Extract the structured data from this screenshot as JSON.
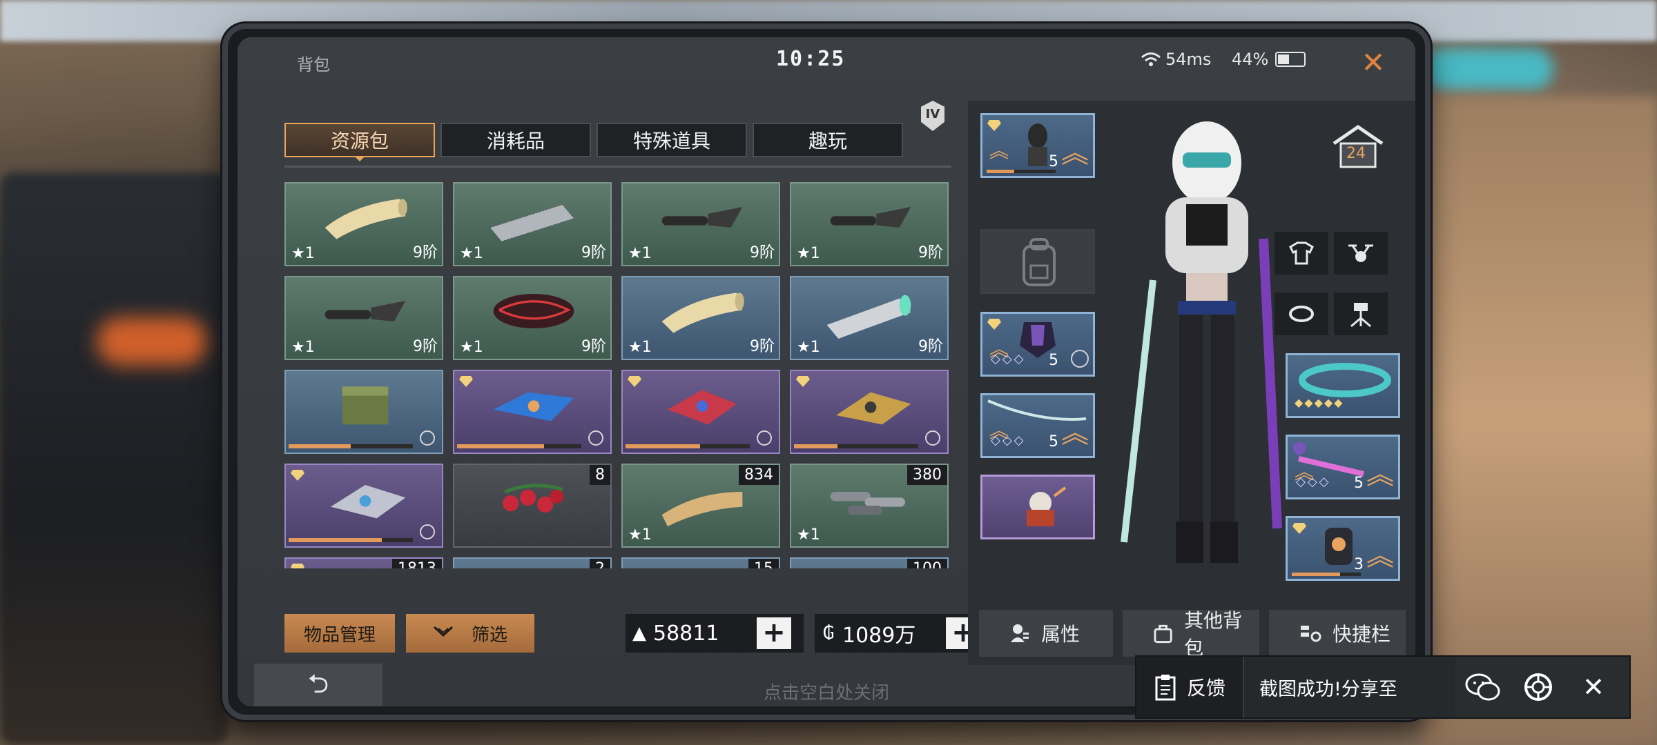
{
  "status": {
    "title": "背包",
    "time": "10:25",
    "ping": "54ms",
    "battery": "44%",
    "battery_level": 0.44
  },
  "tabs": [
    {
      "label": "资源包",
      "active": true
    },
    {
      "label": "消耗品",
      "active": false
    },
    {
      "label": "特殊道具",
      "active": false
    },
    {
      "label": "趣玩",
      "active": false
    }
  ],
  "tier_badge": "IV",
  "items": [
    {
      "icon": "cloth-roll-icon",
      "rarity": "green",
      "star": "1",
      "tier": "9阶"
    },
    {
      "icon": "mesh-roll-icon",
      "rarity": "green",
      "star": "1",
      "tier": "9阶"
    },
    {
      "icon": "gun-stock-icon",
      "rarity": "green",
      "star": "1",
      "tier": "9阶"
    },
    {
      "icon": "gun-stock-icon",
      "rarity": "green",
      "star": "1",
      "tier": "9阶"
    },
    {
      "icon": "gun-stock-icon",
      "rarity": "green",
      "star": "1",
      "tier": "9阶"
    },
    {
      "icon": "armor-plate-icon",
      "rarity": "green",
      "star": "1",
      "tier": "9阶"
    },
    {
      "icon": "cloth-roll-icon",
      "rarity": "blue",
      "star": "1",
      "tier": "9阶"
    },
    {
      "icon": "metal-roll-icon",
      "rarity": "blue",
      "star": "1",
      "tier": "9阶"
    },
    {
      "icon": "supply-crate-icon",
      "rarity": "blue",
      "progress": 0.5
    },
    {
      "icon": "drone-blue-icon",
      "rarity": "purple",
      "progress": 0.7
    },
    {
      "icon": "drone-red-icon",
      "rarity": "purple",
      "progress": 0.6
    },
    {
      "icon": "drone-gold-icon",
      "rarity": "purple",
      "progress": 0.35
    },
    {
      "icon": "drone-silver-icon",
      "rarity": "purple",
      "progress": 0.75
    },
    {
      "icon": "berries-icon",
      "rarity": "gray",
      "count": "8"
    },
    {
      "icon": "parchment-icon",
      "rarity": "green",
      "count": "834",
      "star": "1"
    },
    {
      "icon": "bolts-icon",
      "rarity": "green",
      "count": "380",
      "star": "1"
    },
    {
      "icon": "item-icon",
      "rarity": "purple",
      "count": "1813"
    },
    {
      "icon": "item-icon",
      "rarity": "blue",
      "count": "2"
    },
    {
      "icon": "item-icon",
      "rarity": "blue",
      "count": "15"
    },
    {
      "icon": "item-icon",
      "rarity": "blue",
      "count": "100"
    }
  ],
  "bottom": {
    "manage_label": "物品管理",
    "filter_label": "筛选",
    "gold_value": "58811",
    "coin_value": "1089万"
  },
  "equipment": {
    "head_level": "5",
    "body_level": "5",
    "weapon1_level": "5",
    "weapon2_level": "5",
    "gadget_level": "3",
    "house_level": "24"
  },
  "right_buttons": {
    "attr": "属性",
    "other_bag": "其他背包",
    "hotbar": "快捷栏"
  },
  "hint": "点击空白处关闭",
  "share": {
    "feedback": "反馈",
    "message": "截图成功!分享至"
  },
  "colors": {
    "accent": "#e9a45f",
    "green": "#5f7b6d",
    "blue": "#5e7990",
    "purple": "#6b5c8c"
  }
}
